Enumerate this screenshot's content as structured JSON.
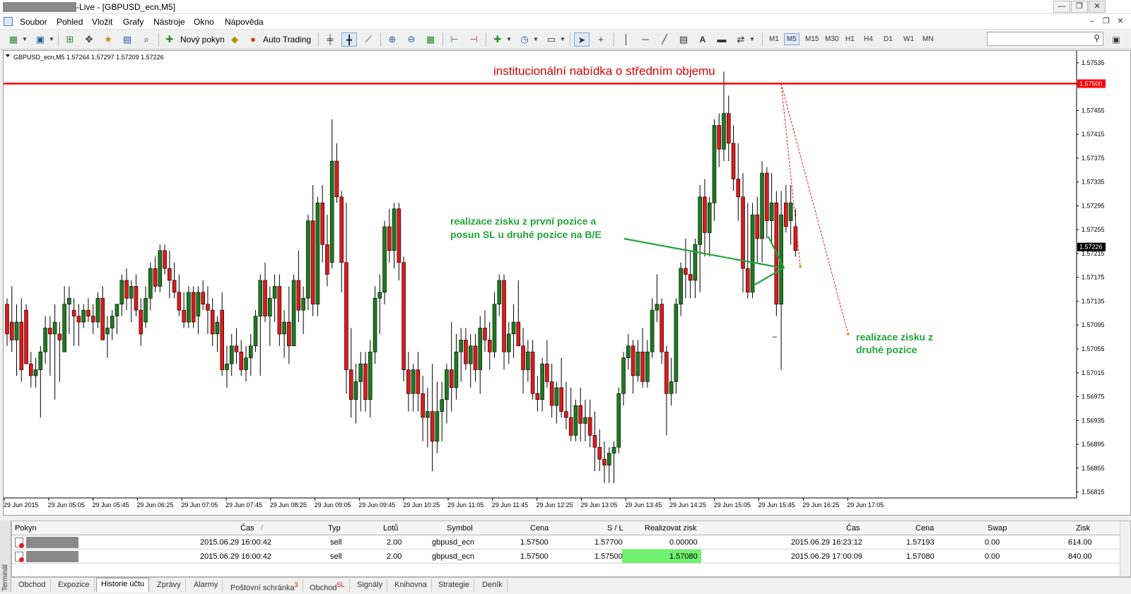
{
  "window": {
    "title": "-Live - [GBPUSD_ecn,M5]",
    "controls": [
      "—",
      "❐",
      "✕"
    ]
  },
  "menu": {
    "items": [
      "Soubor",
      "Pohled",
      "Vložit",
      "Grafy",
      "Nástroje",
      "Okno",
      "Nápověda"
    ],
    "mdi_controls": [
      "–",
      "❐",
      "✕"
    ]
  },
  "toolbar": {
    "new_order": "Nový pokyn",
    "auto_trading": "Auto Trading",
    "draw_text": "A",
    "timeframes": [
      "M1",
      "M5",
      "M15",
      "M30",
      "H1",
      "H4",
      "D1",
      "W1",
      "MN"
    ],
    "active_timeframe": "M5"
  },
  "chart": {
    "info": "GBPUSD_ecn,M5  1.57264 1.57297 1.57209 1.57226",
    "ylim": [
      1.56805,
      1.57555
    ],
    "y_ticks": [
      "1.57535",
      "1.57500",
      "1.57455",
      "1.57415",
      "1.57375",
      "1.57335",
      "1.57295",
      "1.57255",
      "1.57226",
      "1.57215",
      "1.57175",
      "1.57135",
      "1.57095",
      "1.57055",
      "1.57015",
      "1.56975",
      "1.56935",
      "1.56895",
      "1.56855",
      "1.56815"
    ],
    "x_ticks": [
      "29 Jun 2015",
      "29 Jun 05:05",
      "29 Jun 05:45",
      "29 Jun 06:25",
      "29 Jun 07:05",
      "29 Jun 07:45",
      "29 Jun 08:25",
      "29 Jun 09:05",
      "29 Jun 09:45",
      "29 Jun 10:25",
      "29 Jun 11:05",
      "29 Jun 11:45",
      "29 Jun 12:25",
      "29 Jun 13:05",
      "29 Jun 13:45",
      "29 Jun 14:25",
      "29 Jun 15:05",
      "29 Jun 15:45",
      "29 Jun 16:25",
      "29 Jun 17:05"
    ],
    "hline_price": 1.575,
    "hline_label": "1.57500",
    "current_price": 1.57226,
    "current_label": "1.57226",
    "annotations": {
      "institutional": "institucionální nabídka o středním objemu",
      "tp1_line1": "realizace zisku z první pozice a",
      "tp1_line2": "posun SL u druhé pozice na B/E",
      "tp2_line1": "realizace zisku z",
      "tp2_line2": "druhé pozice"
    },
    "colors": {
      "bull": "#1e7a1e",
      "bear": "#dd1a1a",
      "hline": "#ff0000",
      "annotation_red": "#e00000",
      "annotation_green": "#22a43a"
    }
  },
  "chart_data": {
    "type": "candlestick",
    "title": "",
    "symbol": "GBPUSD_ecn",
    "timeframe": "M5",
    "last_ohlc": {
      "open": 1.57264,
      "high": 1.57297,
      "low": 1.57209,
      "close": 1.57226
    },
    "ylim": [
      1.56805,
      1.57555
    ],
    "candles": [
      [
        1.5713,
        1.5714,
        1.5706,
        1.5708
      ],
      [
        1.571,
        1.5716,
        1.5705,
        1.5707
      ],
      [
        1.5707,
        1.5713,
        1.5701,
        1.571
      ],
      [
        1.571,
        1.5714,
        1.57,
        1.5702
      ],
      [
        1.5712,
        1.5713,
        1.5703,
        1.5703
      ],
      [
        1.5703,
        1.5705,
        1.5699,
        1.5701
      ],
      [
        1.5701,
        1.5704,
        1.5699,
        1.5702
      ],
      [
        1.5702,
        1.5706,
        1.5694,
        1.5705
      ],
      [
        1.5705,
        1.5711,
        1.5703,
        1.5709
      ],
      [
        1.5709,
        1.5711,
        1.5701,
        1.5708
      ],
      [
        1.5708,
        1.5713,
        1.5697,
        1.571
      ],
      [
        1.5708,
        1.571,
        1.57,
        1.5707
      ],
      [
        1.5705,
        1.5716,
        1.5705,
        1.5713
      ],
      [
        1.5713,
        1.5716,
        1.5708,
        1.5714
      ],
      [
        1.5712,
        1.5714,
        1.5706,
        1.5711
      ],
      [
        1.5711,
        1.5713,
        1.5706,
        1.571
      ],
      [
        1.571,
        1.5713,
        1.5709,
        1.5712
      ],
      [
        1.5712,
        1.5714,
        1.571,
        1.5711
      ],
      [
        1.5711,
        1.5713,
        1.5708,
        1.571
      ],
      [
        1.571,
        1.5715,
        1.5709,
        1.5714
      ],
      [
        1.5714,
        1.5716,
        1.5707,
        1.5707
      ],
      [
        1.5708,
        1.5711,
        1.5704,
        1.5709
      ],
      [
        1.5709,
        1.5712,
        1.5707,
        1.5711
      ],
      [
        1.5711,
        1.5713,
        1.5708,
        1.5713
      ],
      [
        1.5713,
        1.5718,
        1.5711,
        1.5717
      ],
      [
        1.5717,
        1.5719,
        1.5712,
        1.5714
      ],
      [
        1.5714,
        1.5717,
        1.571,
        1.5716
      ],
      [
        1.5716,
        1.5718,
        1.5711,
        1.5712
      ],
      [
        1.5712,
        1.5714,
        1.5706,
        1.5708
      ],
      [
        1.571,
        1.5716,
        1.5709,
        1.5714
      ],
      [
        1.5714,
        1.572,
        1.5712,
        1.5719
      ],
      [
        1.5719,
        1.5721,
        1.5715,
        1.5716
      ],
      [
        1.5716,
        1.5723,
        1.5715,
        1.5722
      ],
      [
        1.5722,
        1.5723,
        1.5718,
        1.5719
      ],
      [
        1.5719,
        1.5722,
        1.5714,
        1.5717
      ],
      [
        1.5717,
        1.572,
        1.5714,
        1.5715
      ],
      [
        1.5715,
        1.5718,
        1.5711,
        1.5712
      ],
      [
        1.5712,
        1.5715,
        1.5709,
        1.571
      ],
      [
        1.571,
        1.5716,
        1.5709,
        1.5715
      ],
      [
        1.5715,
        1.5716,
        1.5709,
        1.571
      ],
      [
        1.5711,
        1.5716,
        1.5708,
        1.5715
      ],
      [
        1.5715,
        1.5717,
        1.5712,
        1.5713
      ],
      [
        1.5713,
        1.5716,
        1.5708,
        1.5712
      ],
      [
        1.5712,
        1.5714,
        1.5706,
        1.5708
      ],
      [
        1.5708,
        1.5711,
        1.5705,
        1.571
      ],
      [
        1.5712,
        1.5715,
        1.5701,
        1.5702
      ],
      [
        1.5702,
        1.5706,
        1.5699,
        1.5703
      ],
      [
        1.5703,
        1.5708,
        1.5701,
        1.5706
      ],
      [
        1.5706,
        1.5709,
        1.5703,
        1.5705
      ],
      [
        1.5705,
        1.5707,
        1.5701,
        1.5702
      ],
      [
        1.5702,
        1.5706,
        1.57,
        1.5704
      ],
      [
        1.5704,
        1.5708,
        1.5701,
        1.5706
      ],
      [
        1.5706,
        1.5712,
        1.5705,
        1.5711
      ],
      [
        1.5711,
        1.5718,
        1.5701,
        1.5717
      ],
      [
        1.5717,
        1.572,
        1.571,
        1.5711
      ],
      [
        1.5711,
        1.5716,
        1.5706,
        1.5714
      ],
      [
        1.5714,
        1.5718,
        1.571,
        1.5716
      ],
      [
        1.5716,
        1.5718,
        1.5706,
        1.5708
      ],
      [
        1.5708,
        1.5712,
        1.5704,
        1.571
      ],
      [
        1.571,
        1.5716,
        1.5703,
        1.5706
      ],
      [
        1.5706,
        1.5718,
        1.5706,
        1.5717
      ],
      [
        1.5717,
        1.5722,
        1.571,
        1.5712
      ],
      [
        1.5712,
        1.5716,
        1.5708,
        1.5714
      ],
      [
        1.5714,
        1.5728,
        1.5712,
        1.5727
      ],
      [
        1.5727,
        1.5733,
        1.5711,
        1.5713
      ],
      [
        1.5713,
        1.5731,
        1.5711,
        1.573
      ],
      [
        1.573,
        1.5733,
        1.572,
        1.5723
      ],
      [
        1.5723,
        1.5728,
        1.5716,
        1.5718
      ],
      [
        1.572,
        1.5744,
        1.5719,
        1.5737
      ],
      [
        1.5737,
        1.574,
        1.573,
        1.5731
      ],
      [
        1.5731,
        1.5732,
        1.5715,
        1.572
      ],
      [
        1.572,
        1.573,
        1.5698,
        1.5702
      ],
      [
        1.5702,
        1.5709,
        1.5694,
        1.5697
      ],
      [
        1.5697,
        1.5703,
        1.5693,
        1.57
      ],
      [
        1.57,
        1.5705,
        1.5695,
        1.5703
      ],
      [
        1.5703,
        1.5705,
        1.5695,
        1.5697
      ],
      [
        1.5697,
        1.5707,
        1.5694,
        1.5705
      ],
      [
        1.5705,
        1.5716,
        1.5703,
        1.5714
      ],
      [
        1.5714,
        1.5718,
        1.5708,
        1.5715
      ],
      [
        1.5715,
        1.5727,
        1.5713,
        1.5726
      ],
      [
        1.5726,
        1.5729,
        1.572,
        1.5722
      ],
      [
        1.5722,
        1.573,
        1.5719,
        1.5729
      ],
      [
        1.5729,
        1.573,
        1.5717,
        1.572
      ],
      [
        1.572,
        1.5721,
        1.57,
        1.5702
      ],
      [
        1.5702,
        1.5705,
        1.5695,
        1.5698
      ],
      [
        1.5698,
        1.5703,
        1.5695,
        1.5702
      ],
      [
        1.5702,
        1.5705,
        1.5695,
        1.5698
      ],
      [
        1.5698,
        1.5701,
        1.569,
        1.5694
      ],
      [
        1.5694,
        1.5699,
        1.5689,
        1.5695
      ],
      [
        1.5695,
        1.5703,
        1.5685,
        1.569
      ],
      [
        1.569,
        1.57,
        1.5688,
        1.5695
      ],
      [
        1.5695,
        1.57,
        1.569,
        1.5697
      ],
      [
        1.5697,
        1.5703,
        1.5693,
        1.5702
      ],
      [
        1.5702,
        1.571,
        1.5695,
        1.5699
      ],
      [
        1.5699,
        1.5708,
        1.5697,
        1.5705
      ],
      [
        1.5705,
        1.5709,
        1.57,
        1.5707
      ],
      [
        1.5707,
        1.5709,
        1.5702,
        1.5703
      ],
      [
        1.5703,
        1.5708,
        1.5699,
        1.5706
      ],
      [
        1.5706,
        1.5708,
        1.57,
        1.5702
      ],
      [
        1.5702,
        1.5711,
        1.5698,
        1.5709
      ],
      [
        1.5709,
        1.5712,
        1.5705,
        1.5707
      ],
      [
        1.5707,
        1.571,
        1.5702,
        1.5705
      ],
      [
        1.5705,
        1.5715,
        1.5704,
        1.5713
      ],
      [
        1.5713,
        1.5718,
        1.5711,
        1.5717
      ],
      [
        1.5717,
        1.5718,
        1.5702,
        1.5705
      ],
      [
        1.5705,
        1.571,
        1.5703,
        1.5708
      ],
      [
        1.5708,
        1.5713,
        1.5704,
        1.571
      ],
      [
        1.571,
        1.5717,
        1.5706,
        1.5706
      ],
      [
        1.5706,
        1.5709,
        1.5698,
        1.5702
      ],
      [
        1.5702,
        1.5707,
        1.57,
        1.5705
      ],
      [
        1.5705,
        1.5707,
        1.5697,
        1.5698
      ],
      [
        1.5698,
        1.5701,
        1.5695,
        1.5697
      ],
      [
        1.5697,
        1.5704,
        1.5695,
        1.5703
      ],
      [
        1.5703,
        1.5707,
        1.5699,
        1.57
      ],
      [
        1.57,
        1.5703,
        1.5694,
        1.5696
      ],
      [
        1.5696,
        1.57,
        1.5693,
        1.5699
      ],
      [
        1.5699,
        1.5704,
        1.5694,
        1.5695
      ],
      [
        1.5695,
        1.57,
        1.5692,
        1.5694
      ],
      [
        1.5694,
        1.5699,
        1.569,
        1.5691
      ],
      [
        1.5691,
        1.5697,
        1.569,
        1.5696
      ],
      [
        1.5696,
        1.5699,
        1.569,
        1.5693
      ],
      [
        1.5693,
        1.5697,
        1.569,
        1.5694
      ],
      [
        1.5694,
        1.5697,
        1.5689,
        1.5691
      ],
      [
        1.5691,
        1.5695,
        1.5685,
        1.5689
      ],
      [
        1.5689,
        1.5692,
        1.5685,
        1.5687
      ],
      [
        1.5687,
        1.569,
        1.5683,
        1.5686
      ],
      [
        1.5686,
        1.5689,
        1.5683,
        1.5688
      ],
      [
        1.5688,
        1.569,
        1.5683,
        1.5689
      ],
      [
        1.5689,
        1.5699,
        1.5688,
        1.5698
      ],
      [
        1.5698,
        1.5705,
        1.5696,
        1.5704
      ],
      [
        1.5704,
        1.5708,
        1.5702,
        1.5706
      ],
      [
        1.5706,
        1.5707,
        1.5698,
        1.5701
      ],
      [
        1.5701,
        1.5707,
        1.57,
        1.5705
      ],
      [
        1.5705,
        1.5709,
        1.5699,
        1.57
      ],
      [
        1.57,
        1.5707,
        1.5699,
        1.5705
      ],
      [
        1.5705,
        1.5714,
        1.5704,
        1.5712
      ],
      [
        1.5712,
        1.5718,
        1.571,
        1.5713
      ],
      [
        1.5713,
        1.5714,
        1.5703,
        1.5705
      ],
      [
        1.5705,
        1.5706,
        1.5691,
        1.5698
      ],
      [
        1.5698,
        1.5704,
        1.5696,
        1.57
      ],
      [
        1.57,
        1.5714,
        1.5698,
        1.5713
      ],
      [
        1.5713,
        1.572,
        1.5711,
        1.5719
      ],
      [
        1.5719,
        1.5724,
        1.5714,
        1.5718
      ],
      [
        1.5718,
        1.5722,
        1.5714,
        1.5717
      ],
      [
        1.5717,
        1.5724,
        1.5714,
        1.5723
      ],
      [
        1.5723,
        1.5733,
        1.5715,
        1.5731
      ],
      [
        1.5731,
        1.5734,
        1.5721,
        1.5725
      ],
      [
        1.5725,
        1.5731,
        1.5721,
        1.573
      ],
      [
        1.573,
        1.5744,
        1.5727,
        1.5743
      ],
      [
        1.5743,
        1.5745,
        1.5736,
        1.5739
      ],
      [
        1.5739,
        1.5752,
        1.5737,
        1.5745
      ],
      [
        1.5745,
        1.5748,
        1.5737,
        1.574
      ],
      [
        1.574,
        1.5743,
        1.5732,
        1.5734
      ],
      [
        1.5734,
        1.574,
        1.5727,
        1.5731
      ],
      [
        1.5731,
        1.5735,
        1.5715,
        1.5719
      ],
      [
        1.5719,
        1.573,
        1.5714,
        1.5715
      ],
      [
        1.5715,
        1.573,
        1.5714,
        1.5728
      ],
      [
        1.5728,
        1.5731,
        1.572,
        1.5724
      ],
      [
        1.5724,
        1.5737,
        1.572,
        1.5735
      ],
      [
        1.5735,
        1.5736,
        1.5724,
        1.5727
      ],
      [
        1.5727,
        1.5735,
        1.5723,
        1.573
      ],
      [
        1.573,
        1.5732,
        1.5711,
        1.5713
      ],
      [
        1.5713,
        1.5732,
        1.5702,
        1.5728
      ],
      [
        1.573,
        1.5733,
        1.5725,
        1.5726
      ],
      [
        1.5727,
        1.5733,
        1.5723,
        1.573
      ],
      [
        1.5726,
        1.5729,
        1.5721,
        1.5722
      ]
    ]
  },
  "terminal": {
    "side_label": "Terminál",
    "columns": [
      "Pokyn",
      "Čas",
      "Typ",
      "Lotů",
      "Symbol",
      "Cena",
      "S / L",
      "Realizovat zisk",
      "Čas",
      "Cena",
      "Swap",
      "Zisk"
    ],
    "sort_indicator": "/",
    "rows": [
      {
        "time": "2015.06.29 16:00:42",
        "type": "sell",
        "lots": "2.00",
        "symbol": "gbpusd_ecn",
        "price": "1.57500",
        "sl": "1.57700",
        "tp": "0.00000",
        "close_time": "2015.06.29 16:23:12",
        "close_price": "1.57193",
        "swap": "0.00",
        "profit": "614.00"
      },
      {
        "time": "2015.06.29 16:00:42",
        "type": "sell",
        "lots": "2.00",
        "symbol": "gbpusd_ecn",
        "price": "1.57500",
        "sl": "1.57500",
        "tp": "1.57080",
        "close_time": "2015.06.29 17:00:09",
        "close_price": "1.57080",
        "swap": "0.00",
        "profit": "840.00"
      }
    ]
  },
  "tabs": {
    "items": [
      "Obchod",
      "Expozice",
      "Historie účtu",
      "Zprávy",
      "Alarmy",
      "Poštovní schránka",
      "Obchod",
      "Signály",
      "Knihovna",
      "Strategie",
      "Deník"
    ],
    "mail_badge": "3",
    "market_badge": "SL",
    "active": "Historie účtu"
  }
}
